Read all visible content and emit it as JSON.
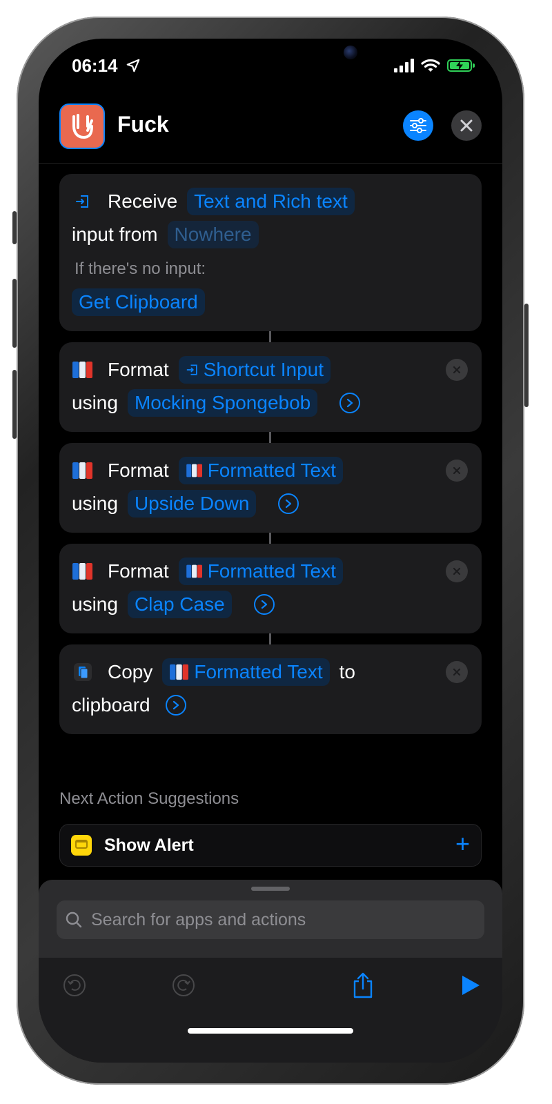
{
  "status": {
    "time": "06:14"
  },
  "header": {
    "title": "Fuck"
  },
  "actions": {
    "receive": {
      "verb": "Receive",
      "types": "Text and Rich text",
      "from_label": "input from",
      "from_value": "Nowhere",
      "no_input_label": "If there's no input:",
      "no_input_value": "Get Clipboard"
    },
    "format1": {
      "verb": "Format",
      "input": "Shortcut Input",
      "using": "using",
      "style": "Mocking Spongebob"
    },
    "format2": {
      "verb": "Format",
      "input": "Formatted Text",
      "using": "using",
      "style": "Upside Down"
    },
    "format3": {
      "verb": "Format",
      "input": "Formatted Text",
      "using": "using",
      "style": "Clap Case"
    },
    "copy": {
      "verb": "Copy",
      "input": "Formatted Text",
      "to": "to",
      "target": "clipboard"
    }
  },
  "suggestions": {
    "title": "Next Action Suggestions",
    "items": [
      {
        "label": "Show Alert",
        "icon": "alert-icon"
      }
    ]
  },
  "search": {
    "placeholder": "Search for apps and actions"
  },
  "colors": {
    "accent": "#0a84ff",
    "card": "#1c1c1e",
    "app_icon": "#e9694f",
    "battery": "#30d158"
  }
}
